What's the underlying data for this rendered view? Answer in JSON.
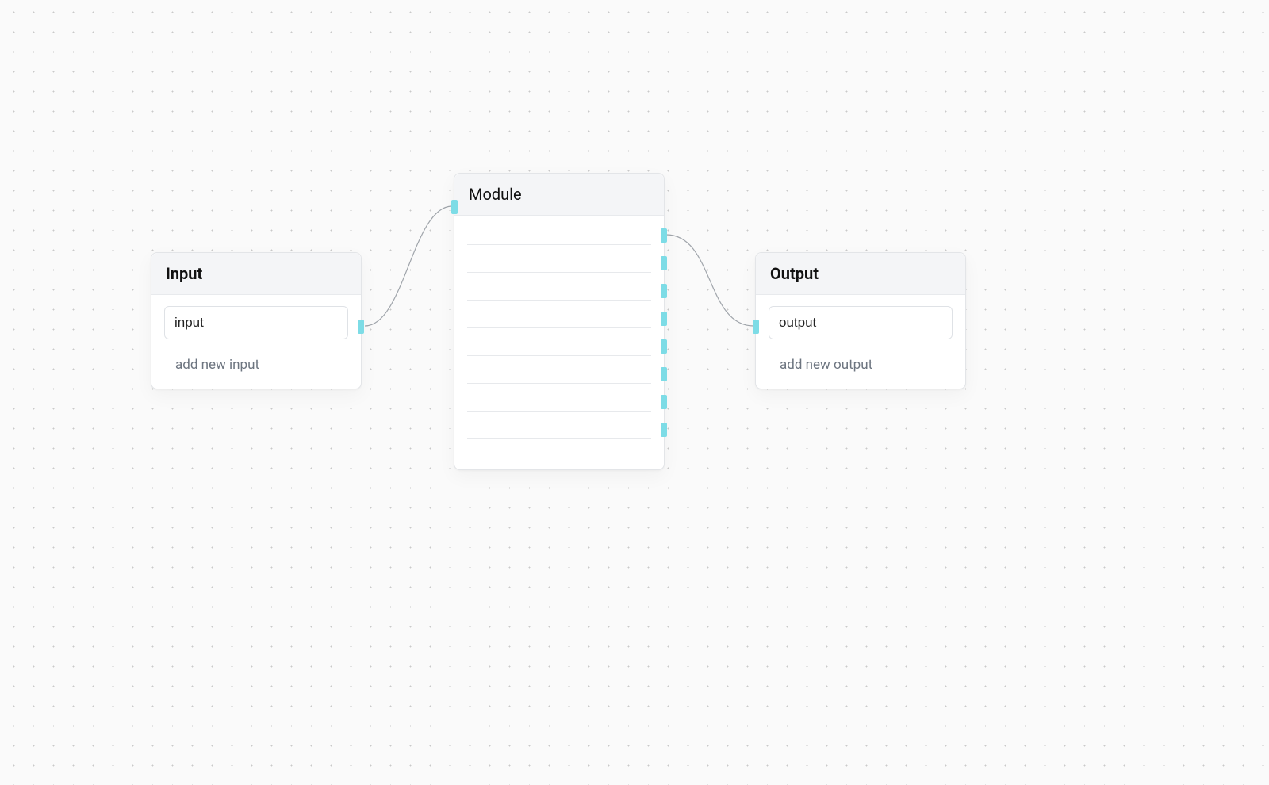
{
  "input_node": {
    "title": "Input",
    "field_value": "input",
    "add_label": "add new input"
  },
  "module_node": {
    "title": "Module",
    "line_count": 8,
    "right_port_count": 8
  },
  "output_node": {
    "title": "Output",
    "field_value": "output",
    "add_label": "add new output"
  }
}
